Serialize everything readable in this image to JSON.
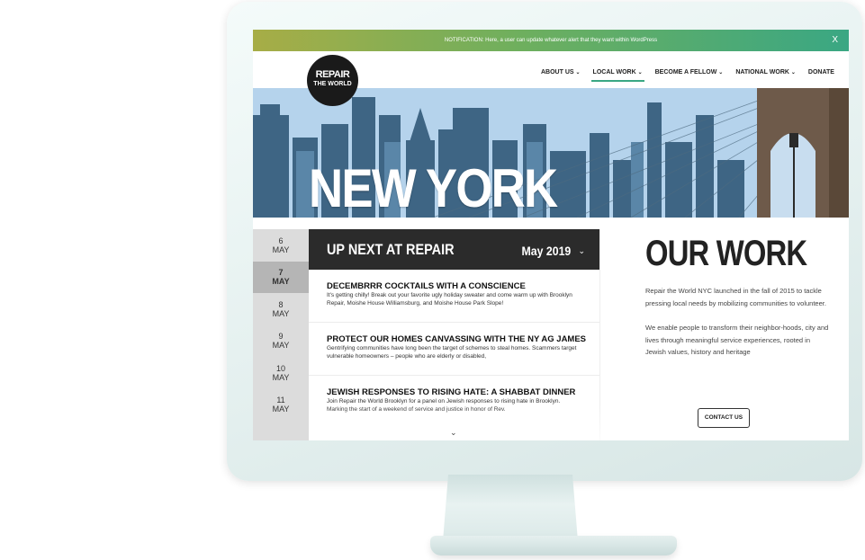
{
  "notification": {
    "text": "NOTIFICATION: Here, a user can update whatever alert that they want within WordPress",
    "close": "X"
  },
  "logo": {
    "line1": "REPAIR",
    "line2": "THE WORLD"
  },
  "nav": [
    {
      "label": "ABOUT US",
      "has_dropdown": true
    },
    {
      "label": "LOCAL WORK",
      "has_dropdown": true,
      "active": true
    },
    {
      "label": "BECOME A FELLOW",
      "has_dropdown": true
    },
    {
      "label": "NATIONAL WORK",
      "has_dropdown": true
    },
    {
      "label": "DONATE",
      "has_dropdown": false
    }
  ],
  "hero": {
    "title": "NEW YORK"
  },
  "dates": [
    {
      "day": "6",
      "month": "MAY"
    },
    {
      "day": "7",
      "month": "MAY",
      "active": true
    },
    {
      "day": "8",
      "month": "MAY"
    },
    {
      "day": "9",
      "month": "MAY"
    },
    {
      "day": "10",
      "month": "MAY"
    },
    {
      "day": "11",
      "month": "MAY"
    }
  ],
  "events": {
    "heading": "UP NEXT AT REPAIR",
    "month": "May 2019",
    "items": [
      {
        "title": "DECEMBRRR COCKTAILS WITH A CONSCIENCE",
        "description": "It's getting chilly! Break out your favorite ugly holiday sweater and come warm up with Brooklyn Repair, Moishe House Williamsburg, and Moishe House Park Slope!"
      },
      {
        "title": "PROTECT OUR HOMES CANVASSING WITH THE NY AG JAMES",
        "description": "Gentrifying communities have long been the target of schemes to steal homes. Scammers target vulnerable homeowners – people who are elderly or disabled,"
      },
      {
        "title": "JEWISH RESPONSES TO RISING HATE: A SHABBAT DINNER",
        "description": "Join Repair the World Brooklyn for a panel on Jewish responses to rising hate in Brooklyn. Marking the start of a weekend of service and justice in honor of Rev."
      }
    ]
  },
  "our_work": {
    "title": "OUR WORK",
    "p1": "Repair the World NYC launched in the fall of 2015 to  tackle pressing local needs by mobilizing communities to volunteer.",
    "p2": "We enable people to transform their  neighbor-hoods, city and lives through meaningful service experiences, rooted in Jewish values, history and heritage",
    "button": "CONTACT US"
  },
  "colors": {
    "accent": "#3aa783",
    "notification_start": "#a7ad46",
    "dark": "#2b2b2b"
  }
}
